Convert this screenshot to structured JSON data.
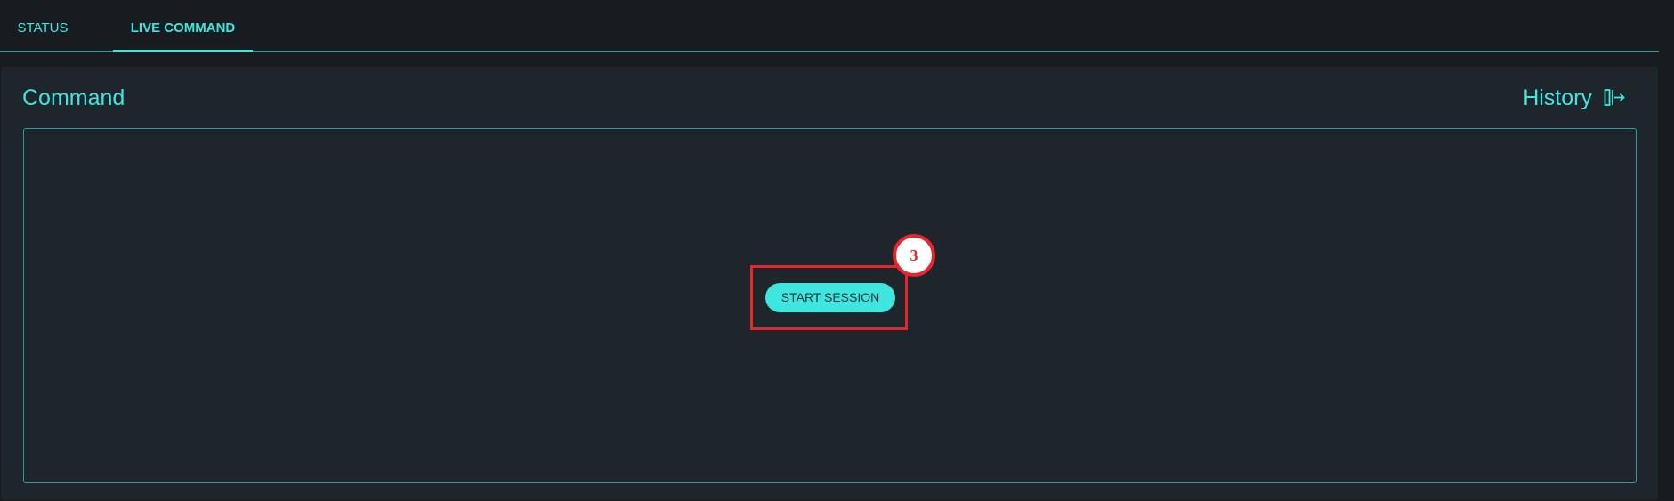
{
  "tabs": [
    {
      "label": "STATUS",
      "active": false
    },
    {
      "label": "LIVE COMMAND",
      "active": true
    }
  ],
  "panel": {
    "title": "Command",
    "history_label": "History",
    "history_icon": "collapse-panel-icon"
  },
  "terminal": {
    "start_button_label": "START SESSION"
  },
  "annotation": {
    "step_number": "3"
  },
  "colors": {
    "accent": "#3fe6e0",
    "border": "#2c9c9a",
    "background": "#181b1f",
    "panel": "#1e262b",
    "highlight": "#e5262e"
  }
}
